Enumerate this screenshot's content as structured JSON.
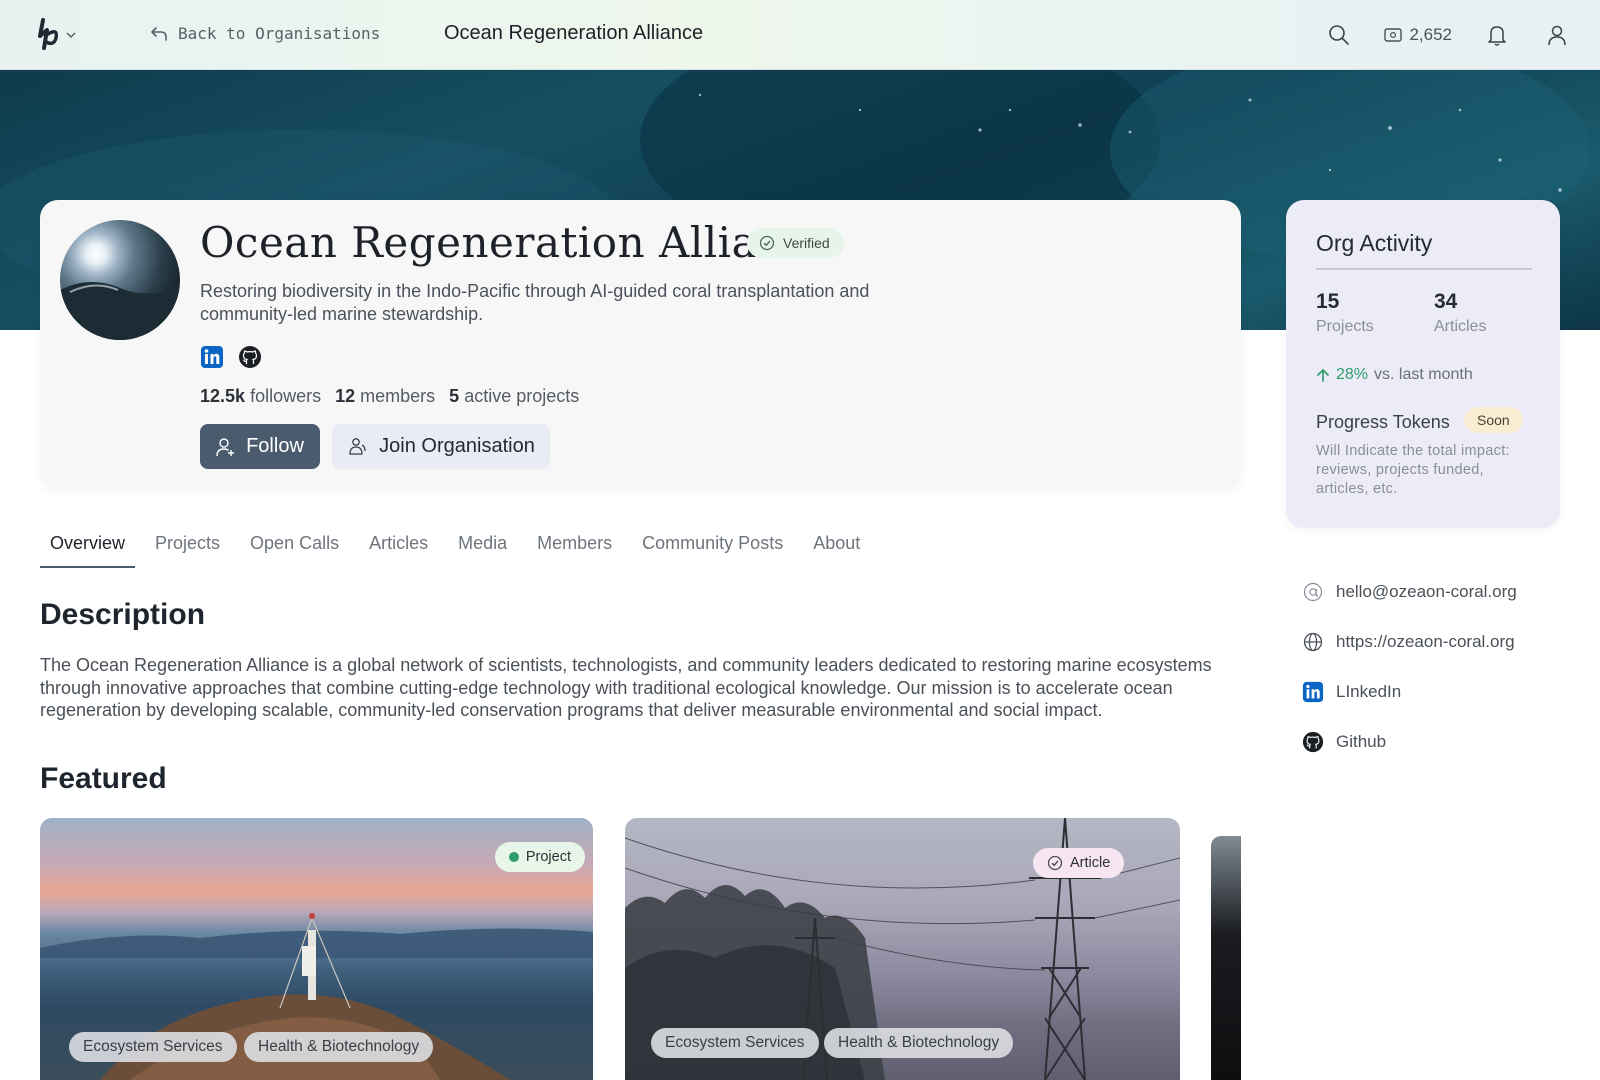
{
  "nav": {
    "back_label": "Back to Organisations",
    "title": "Ocean Regeneration Alliance",
    "tokens": "2,652"
  },
  "profile": {
    "name": "Ocean Regeneration Alliance",
    "verified": "Verified",
    "tagline": "Restoring biodiversity in the Indo-Pacific through AI-guided coral transplantation and community-led marine stewardship.",
    "followers_num": "12.5k",
    "followers_label": "followers",
    "members_num": "12",
    "members_label": "members",
    "projects_num": "5",
    "projects_label": "active projects",
    "follow_label": "Follow",
    "join_label": "Join Organisation"
  },
  "activity": {
    "title": "Org Activity",
    "projects_num": "15",
    "projects_label": "Projects",
    "articles_num": "34",
    "articles_label": "Articles",
    "growth_pct": "28%",
    "growth_label": "vs. last month",
    "tokens_label": "Progress Tokens",
    "soon": "Soon",
    "tokens_desc": "Will Indicate the total impact: reviews, projects funded, articles, etc."
  },
  "contact": {
    "email": "hello@ozeaon-coral.org",
    "website": "https://ozeaon-coral.org",
    "linkedin": "LInkedIn",
    "github": "Github"
  },
  "tabs": [
    "Overview",
    "Projects",
    "Open Calls",
    "Articles",
    "Media",
    "Members",
    "Community Posts",
    "About"
  ],
  "description": {
    "heading": "Description",
    "text": "The Ocean Regeneration Alliance is a global network of scientists, technologists, and community leaders dedicated to restoring marine ecosystems through innovative approaches that combine cutting-edge technology with traditional ecological knowledge. Our mission is to accelerate ocean regeneration by developing scalable, community-led conservation programs that deliver measurable environmental and social impact."
  },
  "featured": {
    "heading": "Featured",
    "cards": [
      {
        "type": "Project",
        "tags": [
          "Ecosystem Services",
          "Health & Biotechnology"
        ]
      },
      {
        "type": "Article",
        "tags": [
          "Ecosystem Services",
          "Health & Biotechnology"
        ]
      }
    ]
  },
  "colors": {
    "accent": "#4a5b6e",
    "verified_bg": "#e7f4e9",
    "activity_bg": "#ecebf8",
    "growth": "#2f9d6a",
    "linkedin": "#0a66c2"
  }
}
